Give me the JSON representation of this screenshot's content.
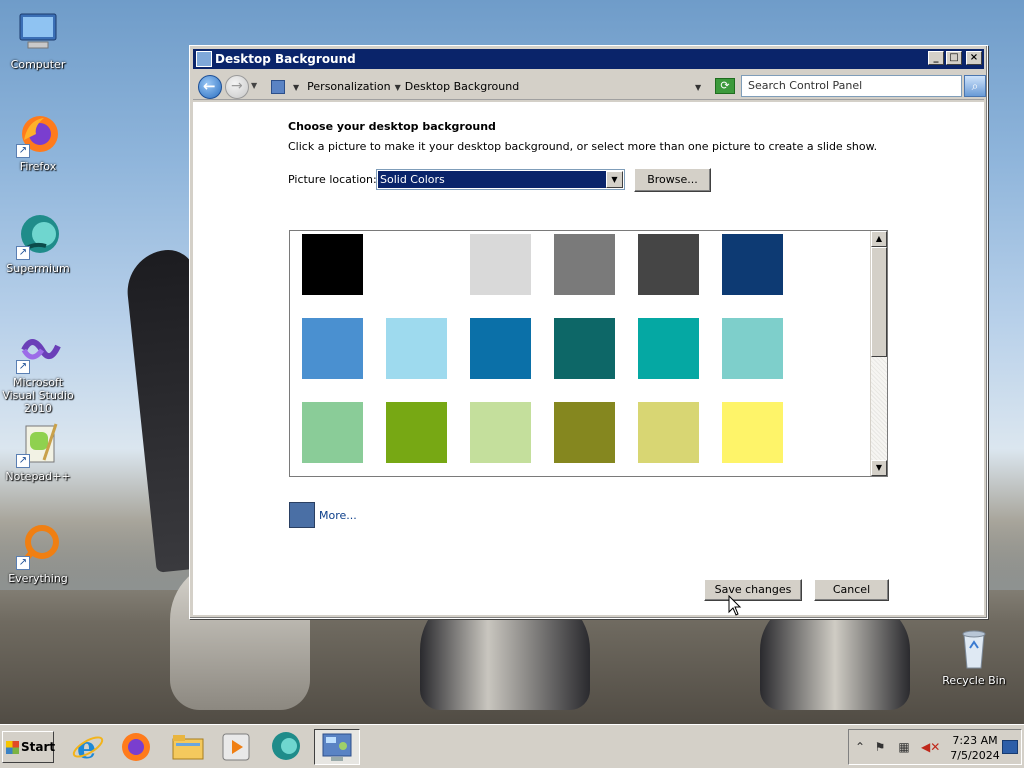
{
  "desktop": {
    "icons": [
      {
        "label": "Computer",
        "icon": "computer-icon"
      },
      {
        "label": "Firefox",
        "icon": "firefox-icon"
      },
      {
        "label": "Supermium",
        "icon": "supermium-icon"
      },
      {
        "label": "Microsoft Visual Studio 2010",
        "icon": "visual-studio-icon"
      },
      {
        "label": "Notepad++",
        "icon": "notepad-plus-plus-icon"
      },
      {
        "label": "Everything",
        "icon": "everything-icon"
      },
      {
        "label": "Recycle Bin",
        "icon": "recycle-bin-icon"
      }
    ]
  },
  "window": {
    "title": "Desktop Background",
    "buttons": {
      "minimize": "_",
      "maximize": "□",
      "close": "×"
    },
    "breadcrumb": [
      "Personalization",
      "Desktop Background"
    ],
    "search_placeholder": "Search Control Panel",
    "heading": "Choose your desktop background",
    "description": "Click a picture to make it your desktop background, or select more than one picture to create a slide show.",
    "picture_location_label": "Picture location:",
    "picture_location_value": "Solid Colors",
    "browse_label": "Browse...",
    "more_label": "More...",
    "more_color": "#4a6fa5",
    "save_label": "Save changes",
    "cancel_label": "Cancel"
  },
  "swatches": [
    [
      "#000000",
      "#ffffff",
      "#d9d9d9",
      "#7a7a7a",
      "#454545",
      "#0d3a73"
    ],
    [
      "#4a90d0",
      "#9edaee",
      "#0b70a8",
      "#0d6767",
      "#05a8a3",
      "#7ecfcb"
    ],
    [
      "#8acc98",
      "#77a814",
      "#c4df9c",
      "#85871f",
      "#d8d673",
      "#fef469"
    ]
  ],
  "taskbar": {
    "start_label": "Start",
    "apps": [
      "internet-explorer-icon",
      "firefox-icon",
      "file-explorer-icon",
      "media-player-icon",
      "supermium-icon",
      "control-panel-icon"
    ],
    "clock_time": "7:23 AM",
    "clock_date": "7/5/2024"
  }
}
